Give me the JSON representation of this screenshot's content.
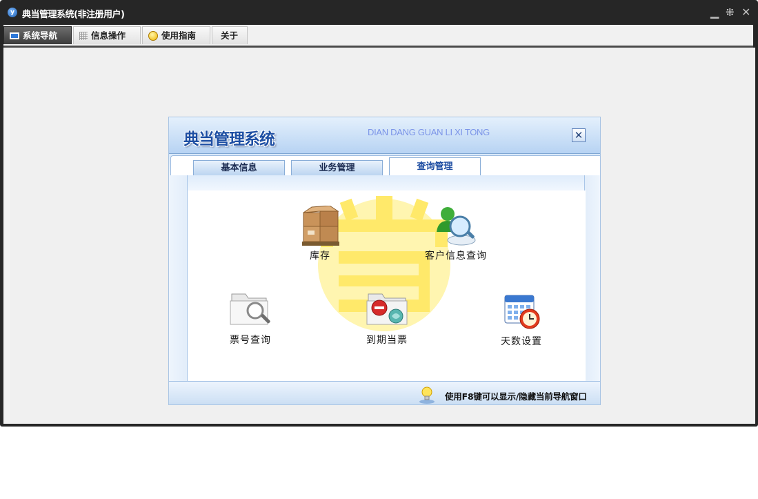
{
  "window": {
    "title": "典当管理系统(非注册用户)",
    "icon": "app-logo-icon",
    "controls": {
      "minimize": "▁",
      "restore": "⁜",
      "close": "✕"
    }
  },
  "menu": {
    "tabs": [
      {
        "label": "系统导航",
        "icon": "monitor-icon",
        "active": true
      },
      {
        "label": "信息操作",
        "icon": "grid-icon",
        "active": false
      },
      {
        "label": "使用指南",
        "icon": "lightbulb-icon",
        "active": false
      },
      {
        "label": "关于",
        "icon": "",
        "active": false
      }
    ]
  },
  "dialog": {
    "title": "典当管理系统",
    "subtitle": "DIAN DANG GUAN LI XI TONG",
    "close": "✕",
    "tabs": [
      {
        "label": "基本信息",
        "active": false
      },
      {
        "label": "业务管理",
        "active": false
      },
      {
        "label": "查询管理",
        "active": true
      }
    ],
    "watermark_icon": "pawnshop-dang-emblem-icon",
    "items": [
      {
        "label": "库存",
        "icon": "warehouse-boxes-icon"
      },
      {
        "label": "客户信息查询",
        "icon": "customer-search-icon"
      },
      {
        "label": "票号查询",
        "icon": "folder-search-icon"
      },
      {
        "label": "到期当票",
        "icon": "expired-ticket-icon"
      },
      {
        "label": "天数设置",
        "icon": "calendar-clock-icon"
      }
    ],
    "footer_tip": "使用F8键可以显示/隐藏当前导航窗口",
    "footer_icon": "lightbulb-tip-icon"
  },
  "colors": {
    "titlebar": "#262626",
    "accent_blue": "#1e4fa3",
    "watermark_yellow": "#ffe96a"
  }
}
